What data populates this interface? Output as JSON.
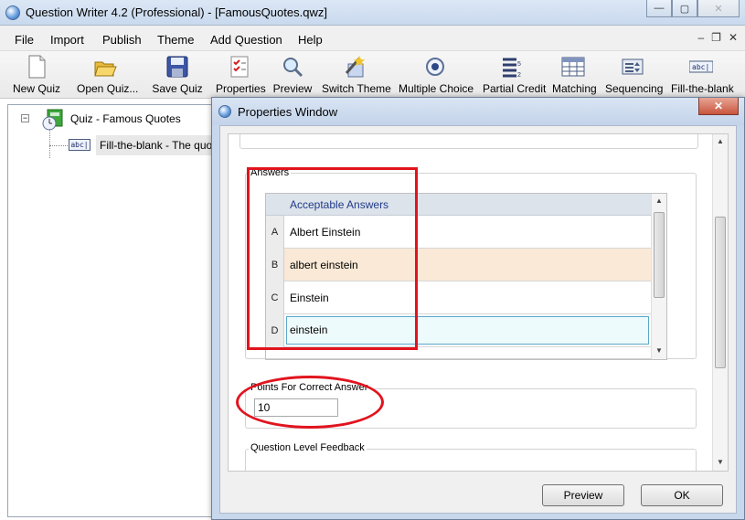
{
  "window": {
    "title": "Question Writer 4.2 (Professional) - [FamousQuotes.qwz]",
    "controls": {
      "minimize": "—",
      "maximize": "▢",
      "close": "✕"
    }
  },
  "menu": {
    "items": [
      "File",
      "Import",
      "Publish",
      "Theme",
      "Add Question",
      "Help"
    ],
    "mdi_controls": {
      "minimize": "–",
      "restore": "❐",
      "close": "✕"
    }
  },
  "toolbar": {
    "items": [
      {
        "label": "New Quiz",
        "icon": "new-document-icon"
      },
      {
        "label": "Open Quiz...",
        "icon": "open-folder-icon"
      },
      {
        "label": "Save Quiz",
        "icon": "floppy-disk-icon"
      },
      {
        "label": "Properties",
        "icon": "checklist-icon"
      },
      {
        "label": "Preview",
        "icon": "magnifier-icon"
      },
      {
        "label": "Switch Theme",
        "icon": "magic-wand-icon"
      },
      {
        "label": "Multiple Choice",
        "icon": "radio-button-icon"
      },
      {
        "label": "Partial Credit",
        "icon": "weighted-list-icon"
      },
      {
        "label": "Matching",
        "icon": "grid-icon"
      },
      {
        "label": "Sequencing",
        "icon": "sequence-icon"
      },
      {
        "label": "Fill-the-blank",
        "icon": "text-field-icon"
      }
    ]
  },
  "tree": {
    "root": {
      "label": "Quiz - Famous Quotes",
      "toggle": "−",
      "icon": "quiz-book-icon"
    },
    "child": {
      "label": "Fill-the-blank - The quote '",
      "icon_text": "abc|"
    }
  },
  "properties": {
    "title": "Properties Window",
    "close": "✕",
    "answers": {
      "group_label": "Answers",
      "column_header": "Acceptable Answers",
      "rows": [
        {
          "letter": "A",
          "text": "Albert Einstein"
        },
        {
          "letter": "B",
          "text": "albert einstein"
        },
        {
          "letter": "C",
          "text": "Einstein"
        },
        {
          "letter": "D",
          "text": "einstein"
        }
      ]
    },
    "points": {
      "group_label": "Points For Correct Answer",
      "value": "10"
    },
    "feedback": {
      "group_label": "Question Level Feedback"
    },
    "buttons": {
      "preview": "Preview",
      "ok": "OK"
    },
    "colors": {
      "row_highlight": "#f9e9d6",
      "input_bg": "#eefbfc",
      "annotation": "#e1141e"
    }
  }
}
